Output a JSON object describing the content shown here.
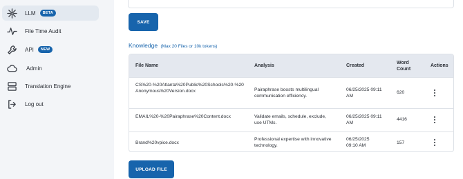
{
  "sidebar": {
    "items": [
      {
        "label": "LLM",
        "icon": "network-sparkle-icon",
        "badge": "BETA"
      },
      {
        "label": "File Time Audit",
        "icon": "activity-pulse-icon"
      },
      {
        "label": "API",
        "icon": "wrench-icon",
        "badge": "NEW"
      },
      {
        "label": "Admin",
        "icon": "cloud-icon"
      },
      {
        "label": "Translation Engine",
        "icon": "server-icon"
      },
      {
        "label": "Log out",
        "icon": "logout-icon"
      }
    ]
  },
  "main": {
    "save_label": "SAVE",
    "knowledge_title": "Knowledge",
    "knowledge_subtitle": "(Max 20 Files or 10k tokens)",
    "upload_label": "UPLOAD FILE",
    "table": {
      "headers": [
        "File Name",
        "Analysis",
        "Created",
        "Word Count",
        "Actions"
      ],
      "rows": [
        {
          "file_name": "CS%20-%20Atlanta%20Public%20Schools%20-%20Anonymous%20Version.docx",
          "analysis": "Pairaphrase boosts multilingual communication efficiency.",
          "created": "06/25/2025 09:11 AM",
          "word_count": "620"
        },
        {
          "file_name": "EMAIL%20-%20Pairaphrase%20Content.docx",
          "analysis": "Validate emails, schedule, exclude, use UTMs.",
          "created": "06/25/2025 09:11 AM",
          "word_count": "4416"
        },
        {
          "file_name": "Brand%20vpice.docx",
          "analysis": "Professional expertise with innovative technology.",
          "created": "06/25/2025 09:10 AM",
          "word_count": "157"
        }
      ]
    }
  }
}
